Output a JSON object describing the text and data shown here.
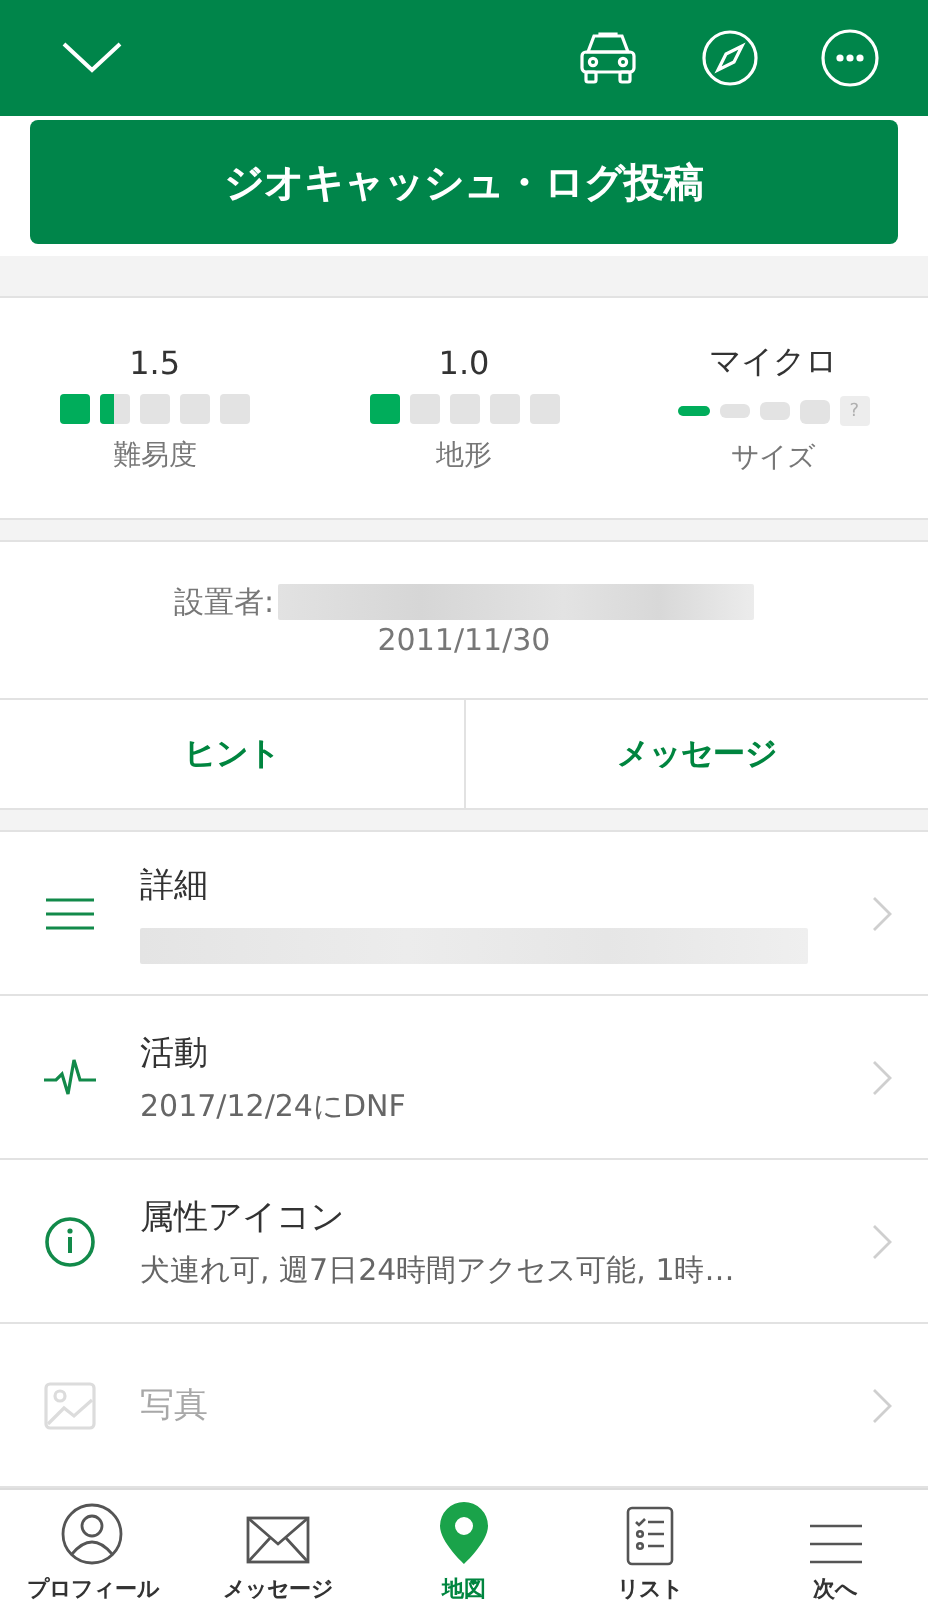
{
  "header": {
    "actions": [
      {
        "kind": "car"
      },
      {
        "kind": "compass"
      },
      {
        "kind": "more"
      }
    ]
  },
  "log_button": "ジオキャッシュ・ログ投稿",
  "ratings": [
    {
      "kind": "squares",
      "value": "1.5",
      "label": "難易度",
      "stars": 1.5
    },
    {
      "kind": "squares",
      "value": "1.0",
      "label": "地形",
      "stars": 1
    },
    {
      "kind": "size",
      "value": "マイクロ",
      "label": "サイズ",
      "stars": 1,
      "unknown_mark": "?"
    }
  ],
  "owner": {
    "label": "設置者:",
    "date": "2011/11/30"
  },
  "actions": [
    "ヒント",
    "メッセージ"
  ],
  "sections": [
    {
      "kind": "details",
      "title": "詳細",
      "disabled": false
    },
    {
      "kind": "activity",
      "title": "活動",
      "subtitle": "2017/12/24にDNF",
      "disabled": false
    },
    {
      "kind": "attributes",
      "title": "属性アイコン",
      "subtitle": "犬連れ可, 週7日24時間アクセス可能, 1時…",
      "disabled": false
    },
    {
      "kind": "photos",
      "title": "写真",
      "disabled": true
    }
  ],
  "tabs": [
    {
      "kind": "profile",
      "label": "プロフィール",
      "selected": false
    },
    {
      "kind": "messages",
      "label": "メッセージ",
      "selected": false
    },
    {
      "kind": "map",
      "label": "地図",
      "selected": true
    },
    {
      "kind": "list",
      "label": "リスト",
      "selected": false
    },
    {
      "kind": "next",
      "label": "次へ",
      "selected": false
    }
  ]
}
